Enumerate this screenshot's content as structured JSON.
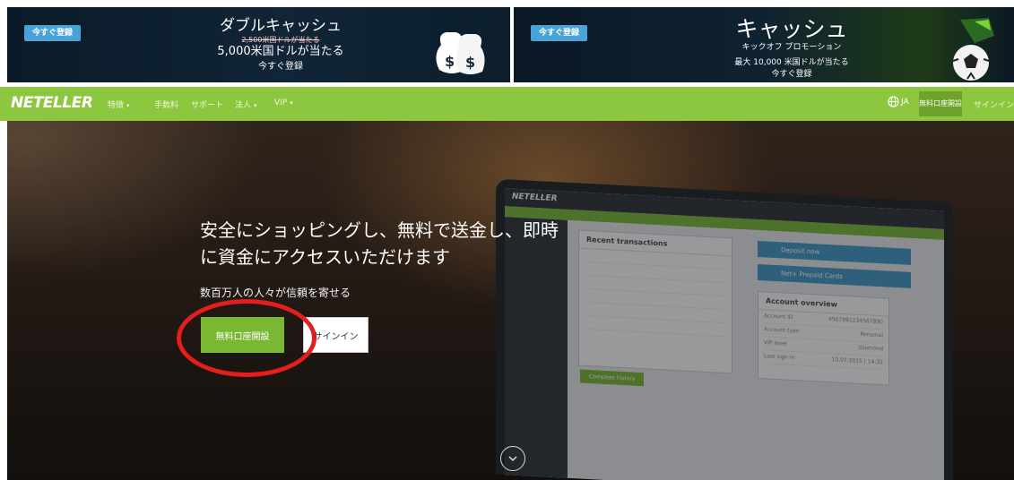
{
  "banners": {
    "left": {
      "button": "今すぐ登録",
      "title": "ダブルキャッシュ",
      "struck": "2,500米国ドルが当たる",
      "amount": "5,000米国ドルが当たる",
      "cta": "今すぐ登録",
      "icon": "moneybags-icon"
    },
    "right": {
      "button": "今すぐ登録",
      "title": "キャッシュ",
      "subtitle": "キックオフ プロモーション",
      "amount": "最大 10,000 米国ドルが当たる",
      "cta": "今すぐ登録",
      "icon": "soccer-ball-icon"
    }
  },
  "nav": {
    "logo": "NETELLER",
    "items": [
      "特徴",
      "手数料",
      "サポート",
      "法人",
      "VIP"
    ],
    "language": "JA",
    "open_account": "無料口座開設",
    "sign_in": "サインイン"
  },
  "hero": {
    "headline_line1": "安全にショッピングし、無料で送金し、即時",
    "headline_line2": "に資金にアクセスいただけます",
    "subheadline": "数百万人の人々が信頼を寄せる",
    "primary_button": "無料口座開設",
    "secondary_button": "サインイン"
  },
  "laptop_screen": {
    "logo": "NETELLER",
    "recent_title": "Recent transactions",
    "deposit_label": "Deposit now",
    "prepaid_label": "Net+ Prepaid Cards",
    "overview_title": "Account overview",
    "overview_rows": [
      "Account ID",
      "Account type",
      "VIP level",
      "Last sign in"
    ],
    "overview_values": [
      "4567891234567890",
      "Personal",
      "Diamond",
      "10.07.2015 | 14:32"
    ],
    "button": "Complete history"
  },
  "colors": {
    "nav_green": "#8dc63f",
    "button_green": "#7ab834",
    "banner_button_blue": "#4aa3d8",
    "annotation_red": "#e41d1d"
  }
}
